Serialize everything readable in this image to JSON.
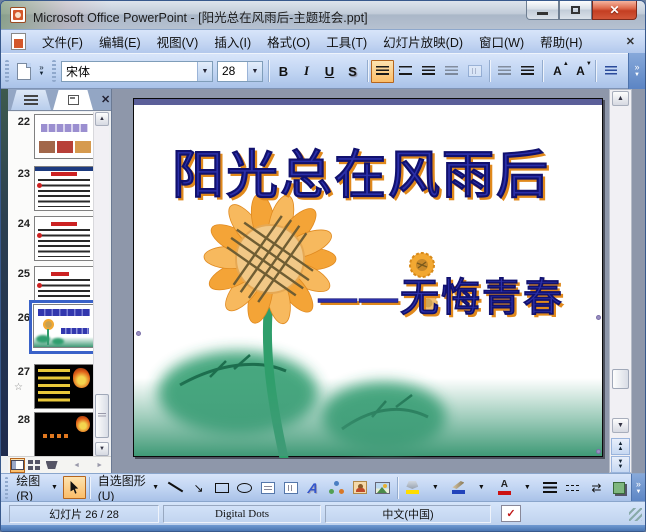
{
  "window": {
    "title": "Microsoft Office PowerPoint - [阳光总在风雨后-主题班会.ppt]"
  },
  "menubar": {
    "items": [
      {
        "label": "文件(F)"
      },
      {
        "label": "编辑(E)"
      },
      {
        "label": "视图(V)"
      },
      {
        "label": "插入(I)"
      },
      {
        "label": "格式(O)"
      },
      {
        "label": "工具(T)"
      },
      {
        "label": "幻灯片放映(D)"
      },
      {
        "label": "窗口(W)"
      },
      {
        "label": "帮助(H)"
      }
    ]
  },
  "format_toolbar": {
    "font_name": "宋体",
    "font_size": "28",
    "bold": "B",
    "italic": "I",
    "underline": "U",
    "shadow": "S"
  },
  "slides_panel": {
    "items": [
      {
        "number": "22"
      },
      {
        "number": "23"
      },
      {
        "number": "24"
      },
      {
        "number": "25"
      },
      {
        "number": "26",
        "selected": true
      },
      {
        "number": "27",
        "animated": true
      },
      {
        "number": "28"
      }
    ]
  },
  "slide": {
    "title": "阳光总在风雨后",
    "subtitle": "——无悔青春"
  },
  "draw_toolbar": {
    "draw_label": "绘图(R)",
    "autoshapes_label": "自选图形(U)"
  },
  "status_bar": {
    "slide_indicator": "幻灯片 26 / 28",
    "design_template": "Digital Dots",
    "language": "中文(中国)"
  },
  "colors": {
    "selection_border": "#3a62c8",
    "close_button": "#c43e22",
    "toolbar_blue": "#c0d4f2",
    "slide_surround": "#8e97aa",
    "wordart_blue": "#2b2fa8",
    "wordart_orange": "#e0891c",
    "fill_color_bar": "#ffdd00",
    "line_color_bar": "#2244bb",
    "font_color_bar": "#cc1111"
  },
  "icons": {
    "dropdown": "▼",
    "up_arrow": "▲",
    "down_arrow": "▼",
    "left_arrow": "◄",
    "right_arrow": "►",
    "chevron": "»",
    "close": "✕",
    "star": "☆",
    "check": "✓",
    "arrow_diag": "↘",
    "swap_arrows": "⇄",
    "letter_a": "A"
  }
}
